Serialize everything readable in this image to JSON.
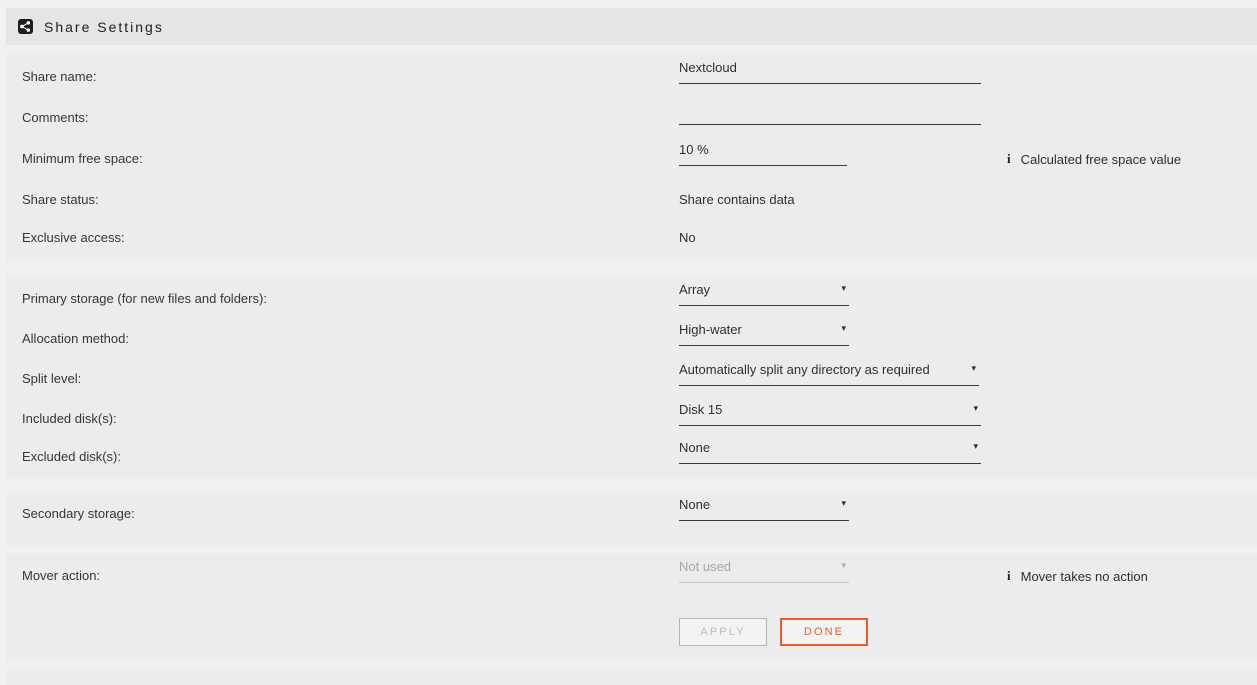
{
  "header": {
    "icon": "share-icon",
    "title": "Share Settings"
  },
  "sections": {
    "general": {
      "share_name": {
        "label": "Share name:",
        "value": "Nextcloud"
      },
      "comments": {
        "label": "Comments:",
        "value": ""
      },
      "minimum_free_space": {
        "label": "Minimum free space:",
        "value": "10 %",
        "note": "Calculated free space value",
        "note_icon": "info-icon"
      },
      "share_status": {
        "label": "Share status:",
        "value": "Share contains data"
      },
      "exclusive_access": {
        "label": "Exclusive access:",
        "value": "No"
      }
    },
    "storage": {
      "primary_storage": {
        "label": "Primary storage (for new files and folders):",
        "value": "Array"
      },
      "allocation_method": {
        "label": "Allocation method:",
        "value": "High-water"
      },
      "split_level": {
        "label": "Split level:",
        "value": "Automatically split any directory as required"
      },
      "included_disks": {
        "label": "Included disk(s):",
        "value": "Disk 15"
      },
      "excluded_disks": {
        "label": "Excluded disk(s):",
        "value": "None"
      }
    },
    "secondary": {
      "secondary_storage": {
        "label": "Secondary storage:",
        "value": "None"
      }
    },
    "mover": {
      "mover_action": {
        "label": "Mover action:",
        "value": "Not used",
        "note": "Mover takes no action",
        "note_icon": "info-icon"
      }
    }
  },
  "buttons": {
    "apply": "APPLY",
    "done": "DONE"
  },
  "colors": {
    "accent": "#ee5b26",
    "panel_bg": "#ececec",
    "page_bg": "#f1f1f1",
    "header_bg": "#e5e5e5",
    "text": "#2f2f2f",
    "disabled_text": "#a6a6a6"
  },
  "caret_glyph": "▾"
}
